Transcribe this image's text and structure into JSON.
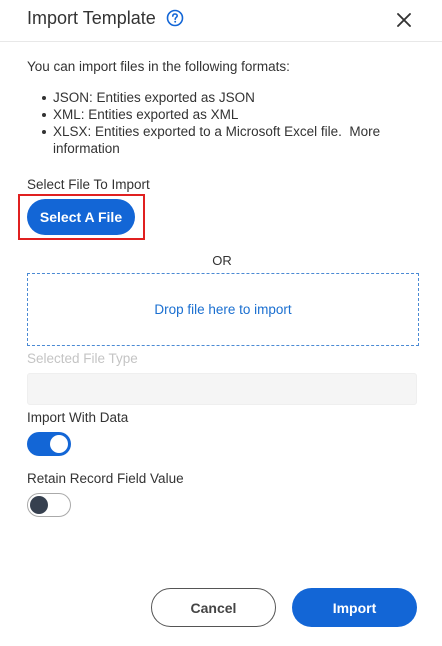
{
  "dialog": {
    "title": "Import Template",
    "help_icon": "question-circle-icon",
    "close_icon": "close-icon"
  },
  "intro": "You can import files in the following formats:",
  "formats": [
    "JSON: Entities exported as JSON",
    "XML: Entities exported as XML",
    "XLSX: Entities exported to a Microsoft Excel file."
  ],
  "more_info_link": "More information",
  "select_file": {
    "label": "Select File To Import",
    "button_label": "Select A File"
  },
  "or_text": "OR",
  "dropzone_text": "Drop file here to import",
  "selected_file_type": {
    "label": "Selected File Type",
    "value": ""
  },
  "import_with_data": {
    "label": "Import With Data",
    "enabled": true
  },
  "retain_record_field_value": {
    "label": "Retain Record Field Value",
    "enabled": false
  },
  "buttons": {
    "cancel": "Cancel",
    "import": "Import"
  },
  "colors": {
    "accent": "#1366d6",
    "highlight": "#e02020",
    "toggle_off_knob": "#36404f"
  }
}
